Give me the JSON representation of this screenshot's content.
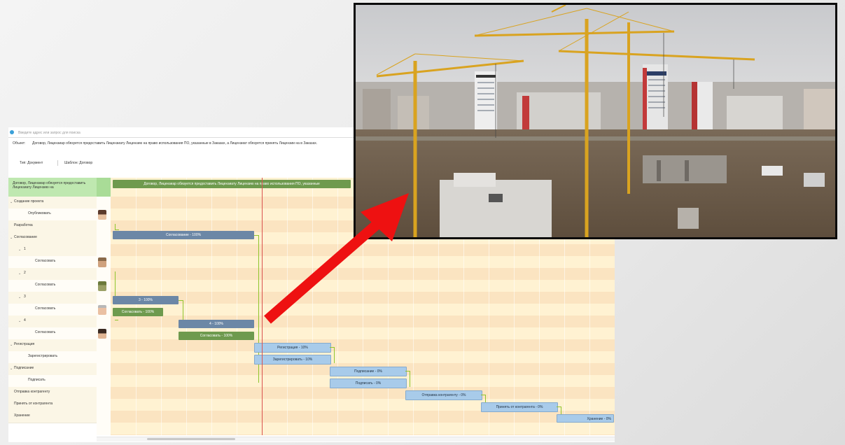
{
  "address_bar": {
    "placeholder": "Введите адрес или запрос для поиска"
  },
  "object": {
    "label": "Объект:",
    "text": "Договор, Лицензиар обязуется предоставить Лицензиату Лицензию на право использования ПО, указанные в Заказах, а Лицензиат обязуется принять Лицензии на в Заказах."
  },
  "fields": {
    "type": "Тип: Документ",
    "template": "Шаблон: Договор"
  },
  "gantt": {
    "header_task": "Договор, Лицензиар обязуется предоставить Лицензиату Лицензию на",
    "header_bar": "Договор, Лицензиар обязуется предоставить Лицензиату Лицензию на право использования ПО, указанные",
    "tasks": [
      "Создание проекта",
      "Опубликовать",
      "Разработка",
      "Согласование",
      "1",
      "Согласовать",
      "2",
      "Согласовать",
      "3",
      "Согласовать",
      "4",
      "Согласовать",
      "Регистрация",
      "Зарегистрировать",
      "Подписание",
      "Подписать",
      "Отправка контрагенту",
      "Принять от контрагента",
      "Хранение"
    ],
    "bars": [
      "Согласование - 100%",
      "3 - 100%",
      "Согласовать - 100%",
      "4 - 100%",
      "Согласовать - 100%",
      "Регистрация - 10%",
      "Зарегистрировать - 10%",
      "Подписание - 0%",
      "Подписать - 0%",
      "Отправка контрагенту - 0%",
      "Принять от контрагента - 0%",
      "Хранение - 0%"
    ]
  },
  "colors": {
    "arrow": "#ee1111",
    "today_line": "#d9534f",
    "connector": "#8fc52d",
    "header_bg": "#bfe8b0"
  },
  "photo": {
    "icon": "construction-site-photo"
  }
}
